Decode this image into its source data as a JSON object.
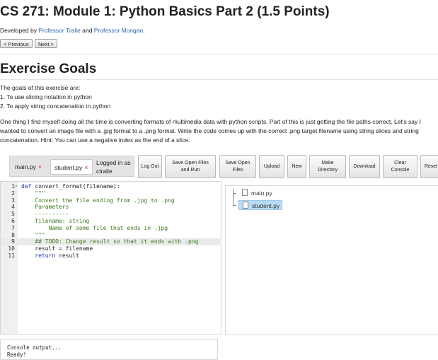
{
  "header": {
    "title": "CS 271: Module 1: Python Basics Part 2 (1.5 Points)",
    "credit_prefix": "Developed by ",
    "author1": "Professor Tralie",
    "credit_and": " and ",
    "author2": "Professor Mongan",
    "credit_suffix": ".",
    "prev_label": "< Previous",
    "next_label": "Next >"
  },
  "goals": {
    "heading": "Exercise Goals",
    "intro": "The goals of this exercise are:",
    "items": [
      "1. To use slicing notation in python",
      "2. To apply string concatenation in python"
    ],
    "description": "One thing I find myself doing all the time is converting formats of multimedia data with python scripts. Part of this is just getting the file paths correct. Let's say I wanted to convert an image file with a .jpg format to a .png format. Write the code comes up with the correct .png target filename using string slices and string concatenation. Hint: You can use a negative index as the end of a slice."
  },
  "toolbar": {
    "tabs": [
      {
        "label": "main.py",
        "close": "×"
      },
      {
        "label": "student.py",
        "close": "×"
      }
    ],
    "logged_in": "Logged in as ctralie",
    "buttons": [
      "Log Out",
      "Save Open Files and Run",
      "Save Open Files",
      "Upload",
      "New",
      "Make Directory",
      "Download",
      "Clear Console",
      "Reset"
    ]
  },
  "editor": {
    "line_numbers": [
      "1",
      "2",
      "3",
      "4",
      "5",
      "6",
      "7",
      "8",
      "9",
      "10",
      "11"
    ],
    "lines": [
      {
        "kw": "def",
        "rest": " convert_format(filename):"
      },
      {
        "cm": "    \"\"\""
      },
      {
        "cm": "    Convert the file ending from .jpg to .png"
      },
      {
        "cm": "    Parameters"
      },
      {
        "cm": "    ----------"
      },
      {
        "cm": "    filename: string"
      },
      {
        "cm": "        Name of some file that ends in .jpg"
      },
      {
        "cm": "    \"\"\""
      },
      {
        "cm": "    ## TODO: Change result so that it ends with .png"
      },
      {
        "pl": "    result = filename"
      },
      {
        "kw": "    return",
        "rest": " result"
      }
    ],
    "highlight_line": 9
  },
  "file_tree": {
    "files": [
      "main.py",
      "student.py"
    ],
    "selected": "student.py"
  },
  "console": {
    "lines": [
      "Console output...",
      "Ready!"
    ]
  }
}
